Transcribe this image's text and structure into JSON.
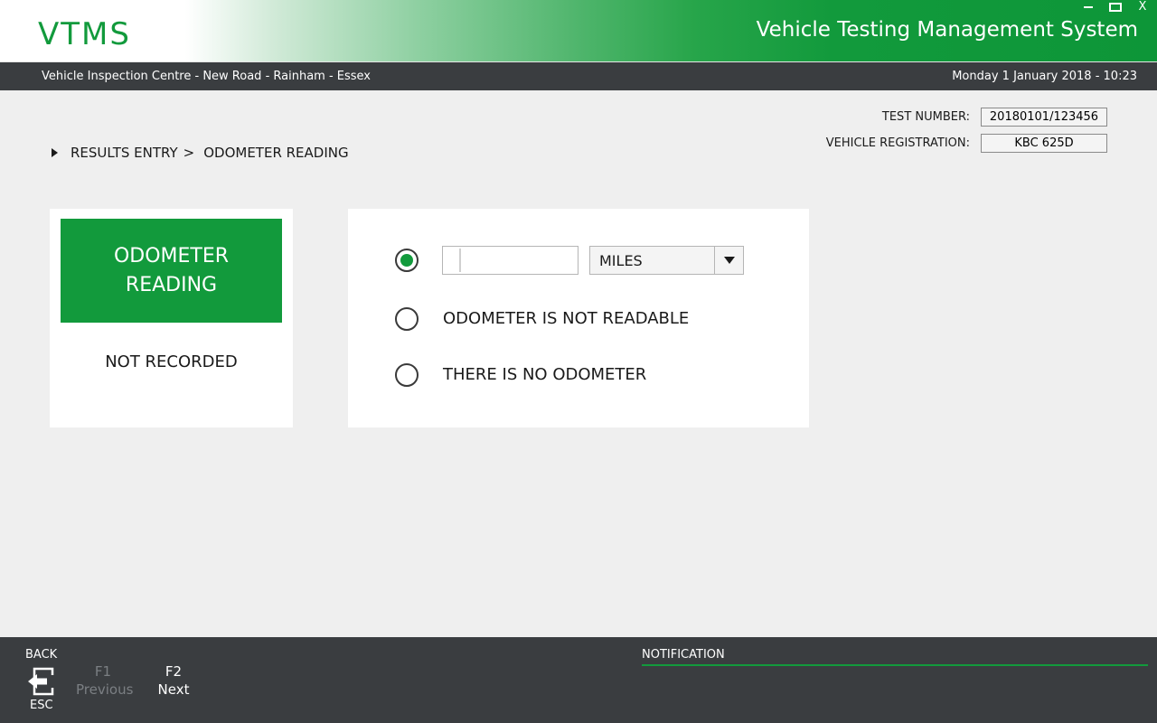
{
  "header": {
    "logo": "VTMS",
    "title": "Vehicle Testing Management System",
    "window_controls": {
      "minimize_icon": "minimize-icon",
      "maximize_icon": "maximize-icon",
      "close": "X"
    }
  },
  "infobar": {
    "location": "Vehicle Inspection Centre - New Road - Rainham - Essex",
    "datetime": "Monday 1 January 2018 - 10:23"
  },
  "test_info": {
    "test_number_label": "TEST NUMBER:",
    "test_number": "20180101/123456",
    "registration_label": "VEHICLE REGISTRATION:",
    "registration": "KBC 625D"
  },
  "breadcrumb": {
    "section": "RESULTS ENTRY",
    "separator": ">",
    "page": "ODOMETER READING"
  },
  "summary_card": {
    "title_line1": "ODOMETER",
    "title_line2": "READING",
    "status": "NOT RECORDED"
  },
  "options": {
    "reading_value": "",
    "unit_selected": "MILES",
    "not_readable_label": "ODOMETER IS NOT READABLE",
    "no_odometer_label": "THERE IS NO ODOMETER",
    "selected_option": "reading"
  },
  "footer": {
    "back_label": "BACK",
    "back_key": "ESC",
    "f1_key": "F1",
    "f1_label": "Previous",
    "f2_key": "F2",
    "f2_label": "Next",
    "notification_label": "NOTIFICATION"
  },
  "colors": {
    "brand_green": "#129a3c",
    "dark_bar": "#3a3d40",
    "background": "#efefef"
  }
}
